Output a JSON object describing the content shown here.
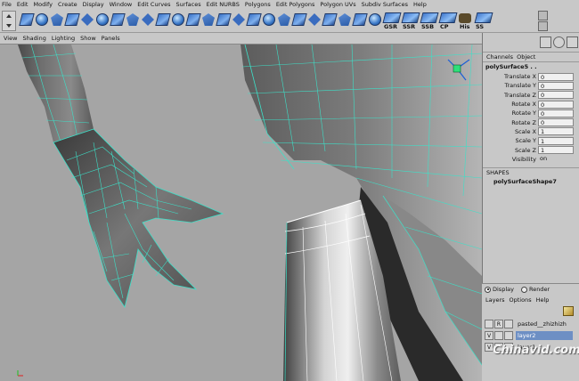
{
  "menubar": [
    "File",
    "Edit",
    "Modify",
    "Create",
    "Display",
    "Window",
    "Edit Curves",
    "Surfaces",
    "Edit NURBS",
    "Polygons",
    "Edit Polygons",
    "Polygon UVs",
    "Subdiv Surfaces",
    "Help"
  ],
  "shelf": {
    "icons": [
      "poly-cube-icon",
      "poly-plane-icon",
      "poly-extrude-icon",
      "poly-sphere-icon",
      "poly-split-icon",
      "poly-combine-icon",
      "poly-smooth-icon",
      "poly-separate-icon",
      "poly-merge-icon",
      "poly-append-icon",
      "poly-bridge-icon",
      "poly-wedge-icon",
      "poly-bevel-icon",
      "poly-cut-icon",
      "poly-poke-icon",
      "poly-duplicate-icon",
      "poly-extract-icon",
      "poly-soften-icon",
      "poly-normals-icon",
      "poly-collapse-icon",
      "poly-delete-icon",
      "poly-subdiv-icon",
      "poly-reduce-icon",
      "poly-fill-icon"
    ],
    "labeled": [
      {
        "label": "GSR",
        "icon": "gsr-icon"
      },
      {
        "label": "SSR",
        "icon": "ssr-icon"
      },
      {
        "label": "SSB",
        "icon": "ssb-icon"
      },
      {
        "label": "CP",
        "icon": "cp-icon"
      },
      {
        "label": "His",
        "icon": "history-icon"
      },
      {
        "label": "SS",
        "icon": "ss-icon"
      }
    ]
  },
  "viewport_menu": [
    "View",
    "Shading",
    "Lighting",
    "Show",
    "Panels"
  ],
  "channel_box": {
    "tabs": [
      "Channels",
      "Object"
    ],
    "object_name": "polySurface5 . .",
    "attributes": [
      {
        "label": "Translate X",
        "value": "0"
      },
      {
        "label": "Translate Y",
        "value": "0"
      },
      {
        "label": "Translate Z",
        "value": "0"
      },
      {
        "label": "Rotate X",
        "value": "0"
      },
      {
        "label": "Rotate Y",
        "value": "0"
      },
      {
        "label": "Rotate Z",
        "value": "0"
      },
      {
        "label": "Scale X",
        "value": "1"
      },
      {
        "label": "Scale Y",
        "value": "1"
      },
      {
        "label": "Scale Z",
        "value": "1"
      },
      {
        "label": "Visibility",
        "value": "on"
      }
    ],
    "shapes_header": "SHAPES",
    "shape_name": "polySurfaceShape7"
  },
  "layer_editor": {
    "mode_display": "Display",
    "mode_render": "Render",
    "menu": [
      "Layers",
      "Options",
      "Help"
    ],
    "layers": [
      {
        "v": "",
        "r": "R",
        "name": "pasted__zhizhizh",
        "selected": false
      },
      {
        "v": "V",
        "r": "",
        "name": "layer2",
        "selected": true
      },
      {
        "v": "V",
        "r": "",
        "name": "layer1",
        "selected": false
      }
    ]
  },
  "watermark": "Chinavid.com",
  "colors": {
    "wire": "#3de0c8",
    "viewport_bg": "#a5a5a5",
    "selection": "#6d8fc4"
  }
}
